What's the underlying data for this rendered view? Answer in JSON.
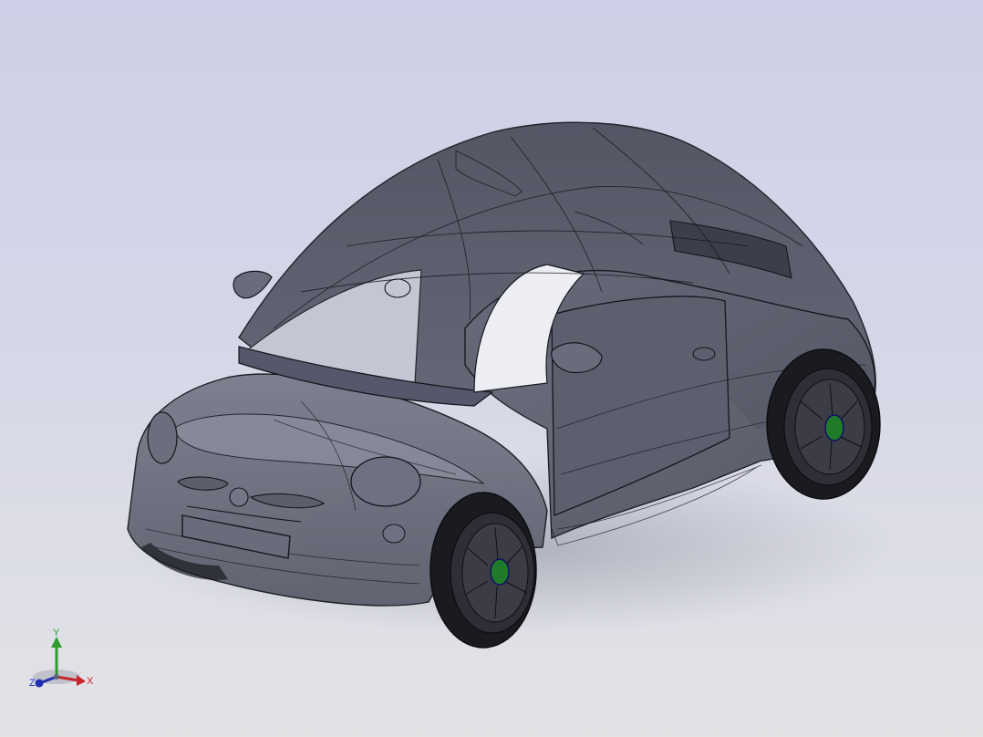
{
  "triad": {
    "x_label": "X",
    "y_label": "Y",
    "z_label": "Z",
    "x_color": "#c8262a",
    "y_color": "#2f9a2f",
    "z_color": "#2030b0"
  },
  "colors": {
    "background_top": "#cdd0e6",
    "background_bottom": "#e3e3e6",
    "body": "#5f6170",
    "edge": "#15161c",
    "hub": "#1f7a2a"
  }
}
